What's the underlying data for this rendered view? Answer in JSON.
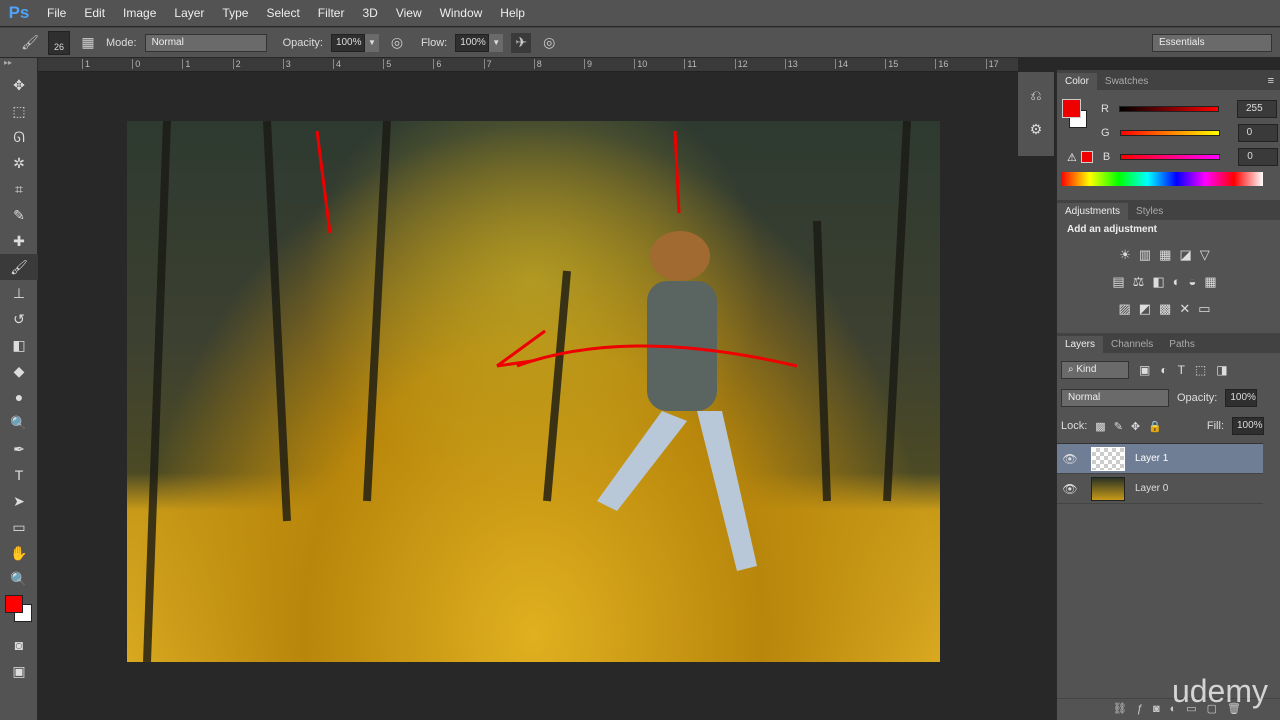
{
  "app": {
    "logo": "Ps"
  },
  "menu": [
    "File",
    "Edit",
    "Image",
    "Layer",
    "Type",
    "Select",
    "Filter",
    "3D",
    "View",
    "Window",
    "Help"
  ],
  "options": {
    "brush_size": "26",
    "mode_label": "Mode:",
    "mode": "Normal",
    "opacity_label": "Opacity:",
    "opacity": "100%",
    "flow_label": "Flow:",
    "flow": "100%",
    "workspace": "Essentials"
  },
  "ruler": [
    "1",
    "0",
    "1",
    "2",
    "3",
    "4",
    "5",
    "6",
    "7",
    "8",
    "9",
    "10",
    "11",
    "12",
    "13",
    "14",
    "15",
    "16",
    "17"
  ],
  "color_panel": {
    "tabs": [
      "Color",
      "Swatches"
    ],
    "r_label": "R",
    "g_label": "G",
    "b_label": "B",
    "r": "255",
    "g": "0",
    "b": "0",
    "foreground": "#ff0000",
    "background": "#ffffff"
  },
  "adjustments": {
    "tabs": [
      "Adjustments",
      "Styles"
    ],
    "title": "Add an adjustment"
  },
  "layers_panel": {
    "tabs": [
      "Layers",
      "Channels",
      "Paths"
    ],
    "kind": "Kind",
    "blend": "Normal",
    "opacity_label": "Opacity:",
    "opacity": "100%",
    "lock_label": "Lock:",
    "fill_label": "Fill:",
    "fill": "100%",
    "layers": [
      {
        "name": "Layer 1",
        "selected": true
      },
      {
        "name": "Layer 0",
        "selected": false
      }
    ]
  },
  "watermark": "udemy"
}
